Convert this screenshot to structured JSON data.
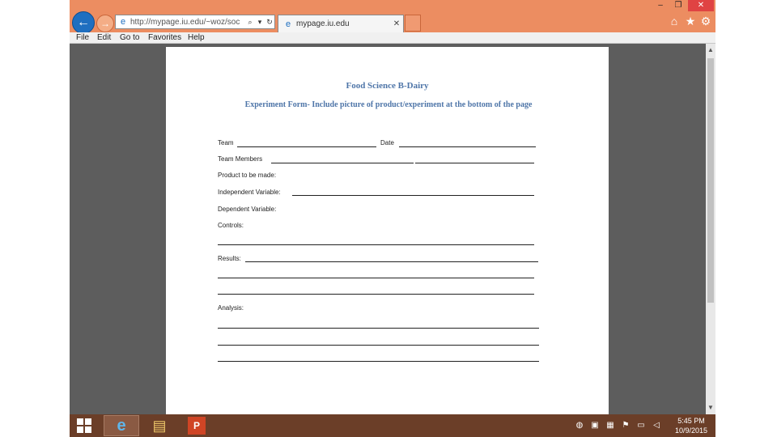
{
  "browser": {
    "url": "http://mypage.iu.edu/~woz/soc",
    "tab_title": "mypage.iu.edu",
    "tab_close": "✕",
    "back_glyph": "←",
    "forward_glyph": "→",
    "search_glyph": "⌕",
    "refresh_glyph": "↻",
    "window": {
      "minimize": "–",
      "restore": "❐",
      "close": "✕"
    },
    "right_icons": {
      "home": "⌂",
      "favorites": "★",
      "tools": "⚙"
    }
  },
  "menu": [
    "File",
    "Edit",
    "Go to",
    "Favorites",
    "Help"
  ],
  "document": {
    "title": "Food Science B-Dairy",
    "subtitle": "Experiment Form- Include picture of product/experiment at the bottom of the page",
    "fields": {
      "team": "Team",
      "date": "Date",
      "team_members": "Team Members",
      "product": "Product to be made:",
      "independent": "Independent Variable:",
      "dependent": "Dependent Variable:",
      "controls": "Controls:",
      "results": "Results:",
      "analysis": "Analysis:"
    }
  },
  "taskbar": {
    "apps": [
      {
        "name": "Internet Explorer",
        "icon": "internet-explorer-icon",
        "glyph": "e"
      },
      {
        "name": "File Explorer",
        "icon": "folder-icon",
        "glyph": "▤"
      },
      {
        "name": "PowerPoint",
        "icon": "powerpoint-icon",
        "glyph": "P"
      }
    ],
    "tray_icons": [
      "network-icon",
      "app-tray-icon",
      "display-icon",
      "flag-icon",
      "monitor-icon",
      "volume-icon"
    ],
    "time": "5:45 PM",
    "date": "10/9/2015"
  },
  "colors": {
    "titlebar": "#ec8d61",
    "taskbar": "#6b3e28",
    "doc_heading": "#4e75a8",
    "viewer_background": "#5d5d5d"
  }
}
